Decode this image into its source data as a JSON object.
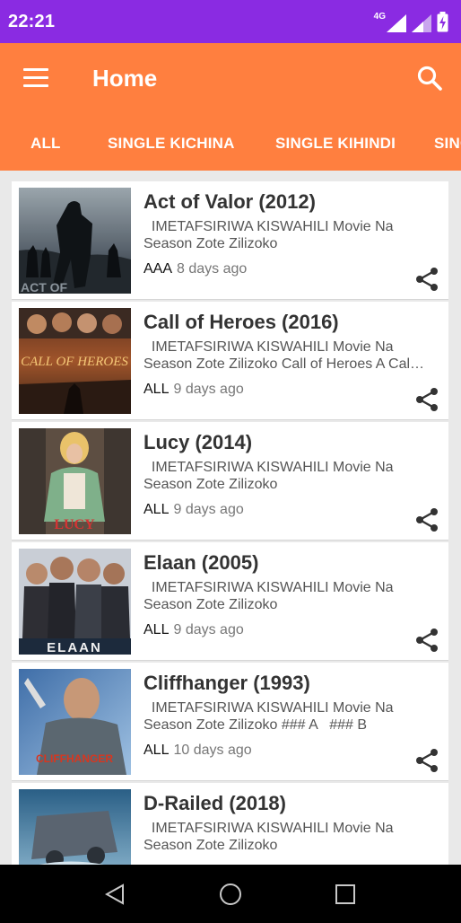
{
  "status": {
    "time": "22:21",
    "network": "4G"
  },
  "appbar": {
    "title": "Home"
  },
  "tabs": [
    "ALL",
    "SINGLE KICHINA",
    "SINGLE KIHINDI",
    "SINGLE"
  ],
  "movies": [
    {
      "title": "Act of Valor (2012)",
      "desc1": "  IMETAFSIRIWA KISWAHILI Movie Na",
      "desc2": "Season Zote Zilizoko",
      "category": "AAA",
      "ago": "8 days ago",
      "poster": "poster-act-of-valor"
    },
    {
      "title": "Call of Heroes (2016)",
      "desc1": "  IMETAFSIRIWA KISWAHILI Movie Na",
      "desc2": "Season Zote Zilizoko Call of Heroes A Cal…",
      "category": "ALL",
      "ago": "9 days ago",
      "poster": "poster-call-of-heroes"
    },
    {
      "title": "Lucy (2014)",
      "desc1": "  IMETAFSIRIWA KISWAHILI Movie Na",
      "desc2": "Season Zote Zilizoko",
      "category": "ALL",
      "ago": "9 days ago",
      "poster": "poster-lucy"
    },
    {
      "title": "Elaan (2005)",
      "desc1": "  IMETAFSIRIWA KISWAHILI Movie Na",
      "desc2": "Season Zote Zilizoko",
      "category": "ALL",
      "ago": "9 days ago",
      "poster": "poster-elaan"
    },
    {
      "title": "Cliffhanger (1993)",
      "desc1": "  IMETAFSIRIWA KISWAHILI Movie Na",
      "desc2": "Season Zote Zilizoko ### A   ### B",
      "category": "ALL",
      "ago": "10 days ago",
      "poster": "poster-cliffhanger"
    },
    {
      "title": "D-Railed (2018)",
      "desc1": "  IMETAFSIRIWA KISWAHILI Movie Na",
      "desc2": "Season Zote Zilizoko",
      "category": "",
      "ago": "",
      "poster": "poster-d-railed"
    }
  ],
  "poster_text": {
    "p1": "ACT OF",
    "p2": "CALL OF HEROES",
    "p3": "LUCY",
    "p4": "ELAAN",
    "p5": "CLIFFHANGER"
  },
  "colors": {
    "status_bar": "#8a2be2",
    "app_bar": "#ff7f3f",
    "background": "#e9e9e9"
  }
}
